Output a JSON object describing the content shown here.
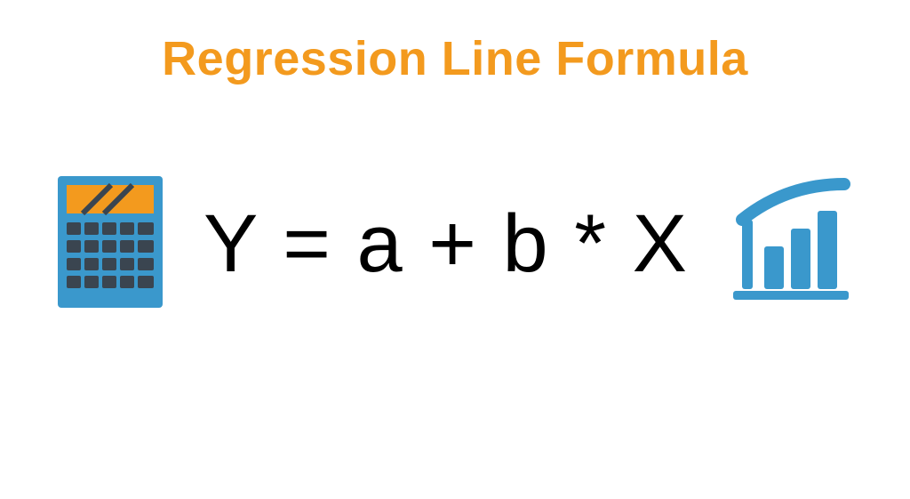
{
  "title": "Regression Line Formula",
  "formula": "Y  =  a + b  *  X",
  "icons": {
    "left": "calculator-icon",
    "right": "growth-chart-icon"
  },
  "colors": {
    "accent": "#f39a1e",
    "chart_blue": "#3a98cc",
    "calc_body": "#3a98cc",
    "calc_screen": "#f39a1e"
  }
}
